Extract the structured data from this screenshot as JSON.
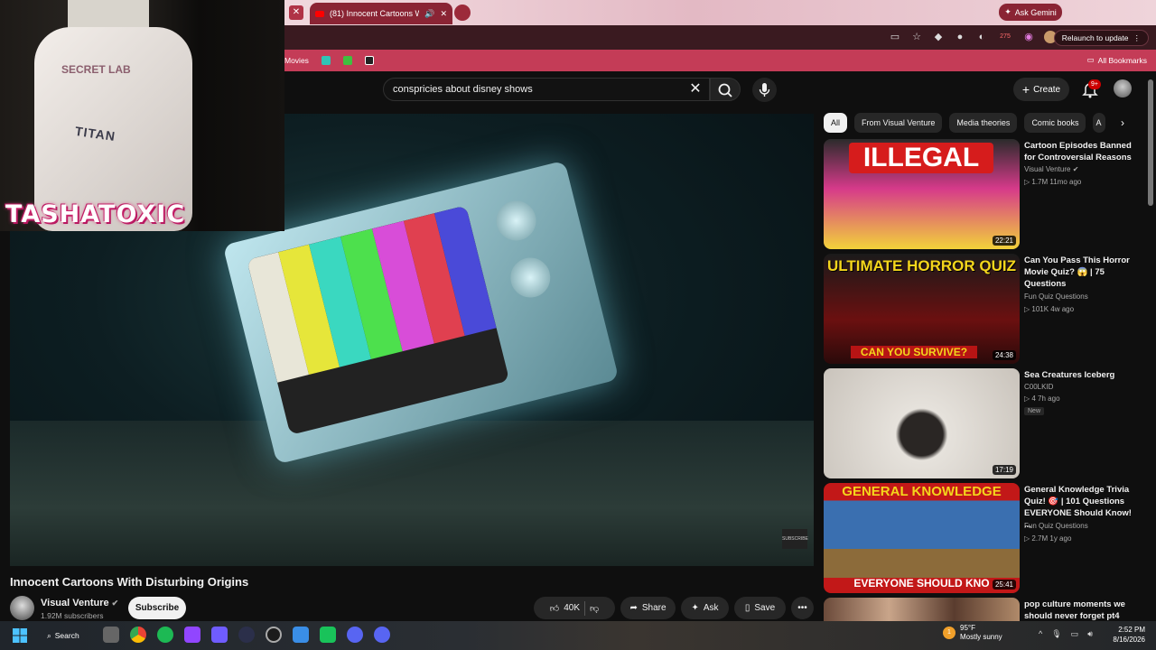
{
  "browser": {
    "active_tab_title": "(81) Innocent Cartoons Wit",
    "gemini_label": "Ask Gemini",
    "relaunch_label": "Relaunch to update",
    "extension_badge": "275",
    "bookmark_label": "Movies",
    "all_bookmarks_label": "All Bookmarks"
  },
  "youtube": {
    "search_value": "conspricies about disney shows",
    "create_label": "Create",
    "notif_badge": "9+"
  },
  "webcam": {
    "handle": "TASHATOXIC",
    "chair_logo": "SECRET LAB",
    "chair_model": "TITAN"
  },
  "video": {
    "title": "Innocent Cartoons With Disturbing Origins",
    "watermark": "SUBSCRIBE",
    "channel": "Visual Venture",
    "subscribers": "1.92M subscribers",
    "subscribe_label": "Subscribe",
    "likes": "40K",
    "share_label": "Share",
    "ask_label": "Ask",
    "save_label": "Save"
  },
  "chips": [
    "All",
    "From Visual Venture",
    "Media theories",
    "Comic books",
    "A"
  ],
  "recommendations": [
    {
      "title": "Cartoon Episodes Banned for Controversial Reasons",
      "channel": "Visual Venture",
      "stats": "1.7M  11mo ago",
      "duration": "22:21",
      "thumb_text": "ILLEGAL"
    },
    {
      "title": "Can You Pass This Horror Movie Quiz? 😱 | 75 Questions",
      "channel": "Fun Quiz Questions",
      "stats": "101K  4w ago",
      "duration": "24:38",
      "thumb_text": "ULTIMATE HORROR QUIZ",
      "thumb_sub": "CAN YOU SURVIVE?"
    },
    {
      "title": "Sea Creatures Iceberg",
      "channel": "C00LKID",
      "stats": "4  7h ago",
      "duration": "17:19",
      "badge": "New"
    },
    {
      "title": "General Knowledge Trivia Quiz! 🎯 | 101 Questions EVERYONE Should Know! ...",
      "channel": "Fun Quiz Questions",
      "stats": "2.7M  1y ago",
      "duration": "25:41",
      "thumb_text": "GENERAL KNOWLEDGE",
      "thumb_sub": "EVERYONE SHOULD KNO"
    },
    {
      "title": "pop culture moments we should never forget pt4"
    }
  ],
  "taskbar": {
    "search_label": "Search",
    "temp": "95°F",
    "weather": "Mostly sunny",
    "weather_badge": "1",
    "time": "2:52 PM",
    "date": "8/16/2026"
  },
  "colors": {
    "accent": "#c43c57",
    "tab": "#8a2434",
    "yt_bg": "#0f0f0f",
    "yt_red": "#ff0000",
    "handle_glow": "#e0327a"
  }
}
